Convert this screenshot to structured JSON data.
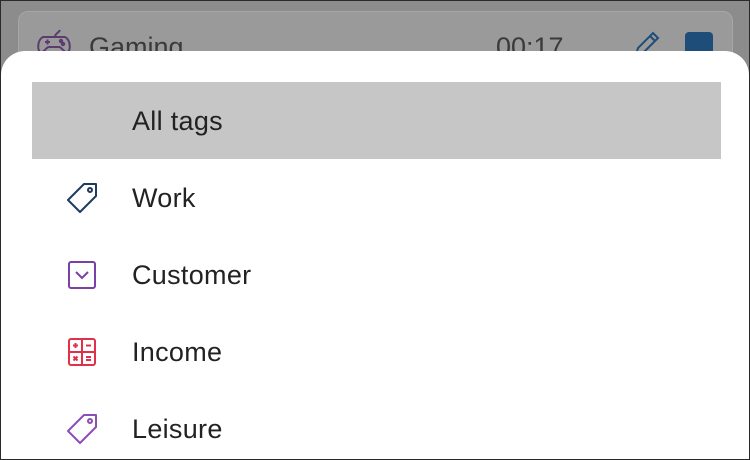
{
  "background_item": {
    "title": "Gaming",
    "time": "00:17",
    "icon": "gamepad-icon",
    "edit_icon": "pencil-icon",
    "stop_icon": "stop-icon"
  },
  "menu": {
    "items": [
      {
        "label": "All tags",
        "icon": "",
        "selected": true
      },
      {
        "label": "Work",
        "icon": "tag-icon",
        "color": "#1f3a5f"
      },
      {
        "label": "Customer",
        "icon": "chevron-box-icon",
        "color": "#7a3fa8"
      },
      {
        "label": "Income",
        "icon": "calculator-icon",
        "color": "#e0304a"
      },
      {
        "label": "Leisure",
        "icon": "tag-icon",
        "color": "#8a4fb5"
      }
    ]
  },
  "colors": {
    "selected_bg": "#c6c6c6",
    "overlay": "#8c8c8c",
    "stop_button": "#1f4d7a"
  }
}
